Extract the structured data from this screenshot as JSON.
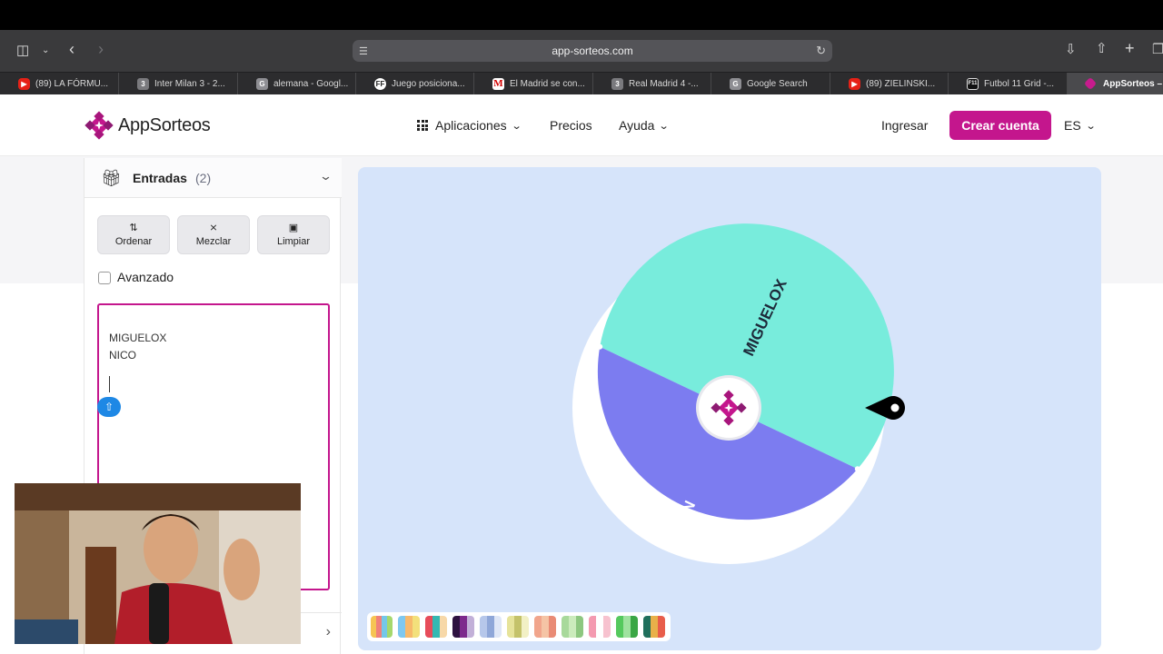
{
  "browser": {
    "url": "app-sorteos.com",
    "tabs": [
      {
        "label": "(89) LA FÓRMU...",
        "icon": "youtube-icon"
      },
      {
        "label": "Inter Milan 3 - 2...",
        "icon": "3"
      },
      {
        "label": "alemana - Googl...",
        "icon": "G"
      },
      {
        "label": "Juego posiciona...",
        "icon": "FF"
      },
      {
        "label": "El Madrid se con...",
        "icon": "M"
      },
      {
        "label": "Real Madrid 4 -...",
        "icon": "3"
      },
      {
        "label": "Google Search",
        "icon": "G"
      },
      {
        "label": "(89) ZIELINSKI...",
        "icon": "youtube-icon"
      },
      {
        "label": "Futbol 11 Grid -...",
        "icon": "F11"
      },
      {
        "label": "AppSorteos – I",
        "icon": "appsorteos-icon"
      }
    ]
  },
  "site": {
    "brand": "AppSorteos",
    "brand_color": "#c4168d",
    "nav": {
      "apps": "Aplicaciones",
      "prices": "Precios",
      "help": "Ayuda",
      "login": "Ingresar",
      "signup": "Crear cuenta",
      "lang": "ES"
    },
    "panel": {
      "title": "Entradas",
      "count": "(2)",
      "buttons": {
        "sort": "Ordenar",
        "shuffle": "Mezclar",
        "clear": "Limpiar"
      },
      "advanced": "Avanzado",
      "entries": [
        "MIGUELOX",
        "NICO"
      ]
    },
    "wheel": {
      "segments": [
        {
          "label": "MIGUELOX",
          "color": "#78ecdc"
        },
        {
          "label": "NICO",
          "color": "#7c7cf0"
        }
      ],
      "background": "#d6e4fa"
    }
  }
}
